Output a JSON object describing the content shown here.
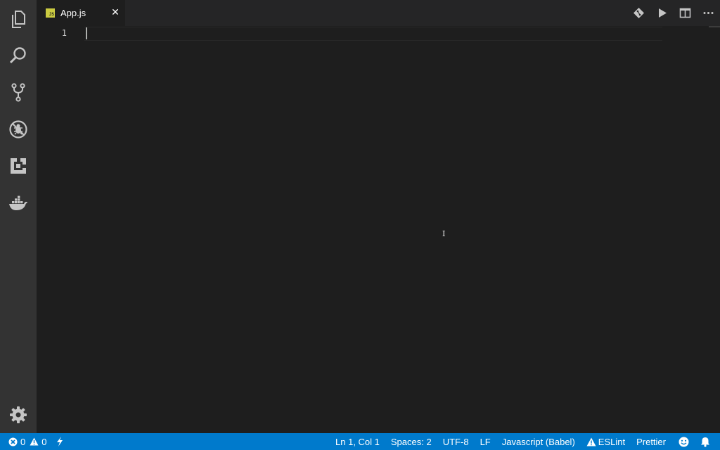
{
  "activity_bar": {
    "items": [
      {
        "name": "explorer",
        "icon": "files-icon"
      },
      {
        "name": "search",
        "icon": "search-icon"
      },
      {
        "name": "source-control",
        "icon": "source-control-icon"
      },
      {
        "name": "debug",
        "icon": "debug-icon"
      },
      {
        "name": "extensions",
        "icon": "extensions-icon"
      },
      {
        "name": "docker",
        "icon": "docker-icon"
      }
    ],
    "bottom": {
      "name": "settings",
      "icon": "gear-icon"
    }
  },
  "tab": {
    "label": "App.js",
    "file_icon_text": "JS",
    "close_glyph": "✕"
  },
  "editor_actions": [
    "git-compare-icon",
    "run-icon",
    "split-editor-icon",
    "more-icon"
  ],
  "editor": {
    "line_numbers": [
      "1"
    ],
    "content": "",
    "text_cursor_glyph": "I"
  },
  "status_bar": {
    "errors": "0",
    "warnings": "0",
    "position": "Ln 1, Col 1",
    "indentation": "Spaces: 2",
    "encoding": "UTF-8",
    "eol": "LF",
    "language": "Javascript (Babel)",
    "eslint": "ESLint",
    "prettier": "Prettier"
  },
  "colors": {
    "activity_bar": "#333333",
    "editor_bg": "#1e1e1e",
    "tab_bar": "#252526",
    "status_bar": "#007acc",
    "js_icon": "#cbcb41"
  }
}
